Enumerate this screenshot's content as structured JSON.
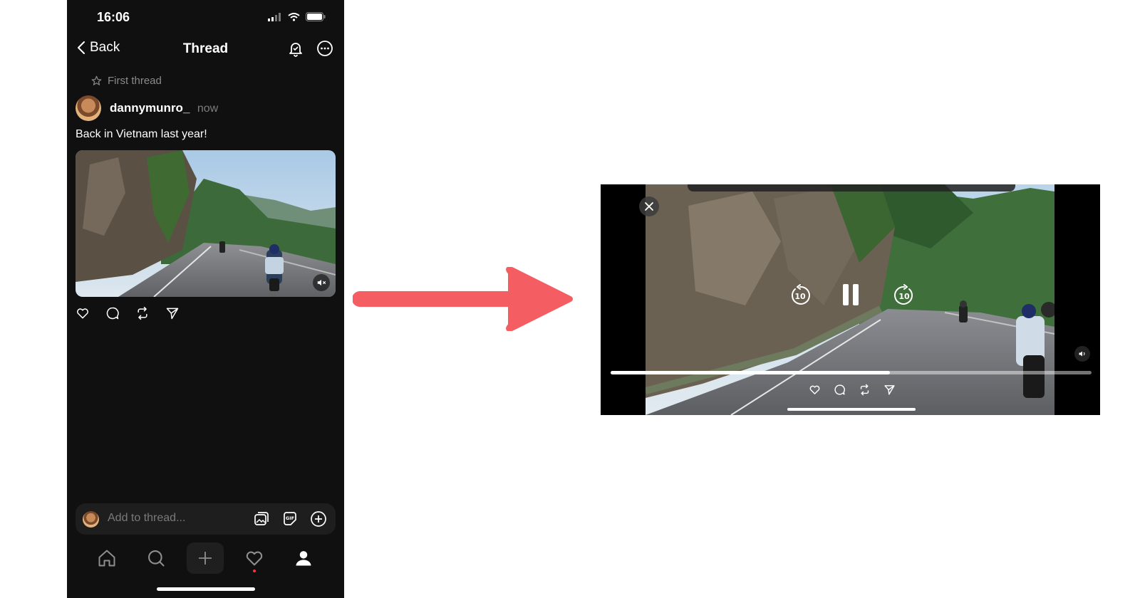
{
  "status_bar": {
    "time": "16:06"
  },
  "nav": {
    "back_label": "Back",
    "title": "Thread"
  },
  "thread_tag": "First thread",
  "post": {
    "username": "dannymunro_",
    "timestamp": "now",
    "text": "Back in Vietnam last year!",
    "media_muted": true
  },
  "compose": {
    "placeholder": "Add to thread..."
  },
  "tabs": [
    "home",
    "search",
    "create",
    "activity",
    "profile"
  ],
  "player": {
    "skip_back_label": "10",
    "skip_forward_label": "10",
    "progress": 0.58,
    "state": "playing"
  },
  "colors": {
    "arrow": "#f45e63",
    "phone_bg": "#101010",
    "notification_dot": "#ff3040"
  }
}
